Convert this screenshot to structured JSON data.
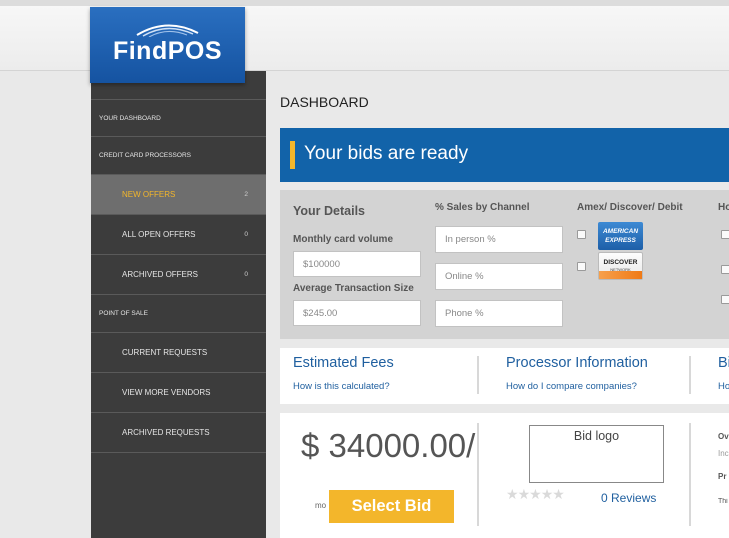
{
  "brand": {
    "name": "FindPOS",
    "color": "#1a5fb0",
    "accent": "#f3b62b"
  },
  "sidebar": {
    "items": [
      {
        "label": "YOUR DASHBOARD"
      },
      {
        "label": "CREDIT CARD PROCESSORS"
      },
      {
        "label": "NEW OFFERS",
        "count": "2"
      },
      {
        "label": "ALL OPEN OFFERS",
        "count": "0"
      },
      {
        "label": "ARCHIVED OFFERS",
        "count": "0"
      },
      {
        "label": "POINT OF SALE"
      },
      {
        "label": "CURRENT REQUESTS"
      },
      {
        "label": "VIEW MORE VENDORS"
      },
      {
        "label": "ARCHIVED REQUESTS"
      }
    ]
  },
  "main": {
    "title": "DASHBOARD",
    "banner": "Your bids are ready",
    "details": {
      "heading": "Your Details",
      "monthly_label": "Monthly card volume",
      "monthly_value": "$100000",
      "avg_label": "Average Transaction Size",
      "avg_value": "$245.00",
      "channel_heading": "% Sales by Channel",
      "in_person_placeholder": "In person %",
      "online_placeholder": "Online %",
      "phone_placeholder": "Phone %",
      "cards_heading": "Amex/ Discover/ Debit",
      "amex_logo": "AMERICAN EXPRESS",
      "discover_logo": "DISCOVER",
      "discover_sub": "NETWORK",
      "next_heading": "Ho"
    },
    "fees": {
      "estimated_title": "Estimated Fees",
      "estimated_link": "How is this calculated?",
      "processor_title": "Processor Information",
      "processor_link": "How do I compare companies?",
      "third_title": "Bi",
      "third_link": "Ho"
    },
    "bid": {
      "price": "$ 34000.00/",
      "per": "mo",
      "select_label": "Select Bid",
      "logo_label": "Bid logo",
      "rating": 0,
      "reviews": "0 Reviews",
      "side_labels": [
        "Ov",
        "Inc",
        "Pr",
        "Thi"
      ]
    }
  }
}
